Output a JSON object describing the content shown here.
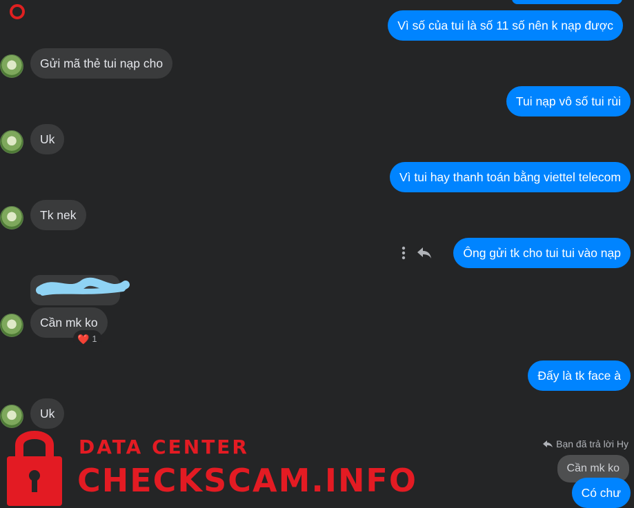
{
  "messages": {
    "out_1": "Vì số của tui là số 11 số nên k nạp được",
    "in_1": "Gửi mã thẻ tui nạp cho",
    "out_2": "Tui nạp vô số tui rùi",
    "in_2": "Uk",
    "out_3": "Vì tui hay thanh toán bằng viettel telecom",
    "in_3": "Tk nek",
    "out_4": "Ông gửi tk cho tui tui vào nạp",
    "in_4": "Cần mk ko",
    "out_5": "Đấy là tk face à",
    "in_5": "Uk",
    "quoted": "Cần mk ko",
    "out_6": "Có chư"
  },
  "reaction": {
    "emoji": "❤️",
    "count": "1"
  },
  "reply_note": "Bạn đã trả lời Hy",
  "watermark": {
    "title": "DATA CENTER",
    "subtitle": "CHECKSCAM.INFO"
  },
  "colors": {
    "background": "#242526",
    "incoming": "#3a3b3c",
    "outgoing": "#0084ff",
    "watermark": "#e31b23"
  }
}
